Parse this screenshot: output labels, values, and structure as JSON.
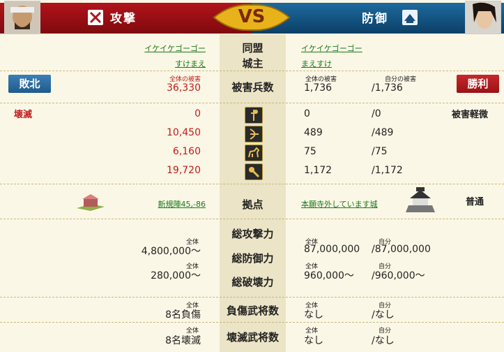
{
  "header": {
    "attack_title": "攻撃",
    "defense_title": "防御",
    "vs": "VS",
    "colors": {
      "attack": "#a31017",
      "defense": "#165a8c",
      "vs_gold": "#e8b31a"
    }
  },
  "alliance": {
    "label": "同盟",
    "attacker": "イケイケゴーゴー",
    "defender": "イケイケゴーゴー"
  },
  "lord": {
    "label": "城主",
    "attacker": "すけまえ",
    "defender": "まえすけ"
  },
  "casualties": {
    "label": "被害兵数",
    "attacker_caption": "全体の被害",
    "attacker_total": "36,330",
    "defender_caption_total": "全体の被害",
    "defender_caption_self": "自分の被害",
    "defender_total": "1,736",
    "defender_self": "/1,736",
    "attacker_result": "敗北",
    "defender_result": "勝利"
  },
  "units": {
    "attacker_status": "壊滅",
    "defender_status": "被害軽微",
    "rows": [
      {
        "icon": "spearman-icon",
        "attacker": "0",
        "defender": "0",
        "defender_self": "/0"
      },
      {
        "icon": "archer-icon",
        "attacker": "10,450",
        "defender": "489",
        "defender_self": "/489"
      },
      {
        "icon": "cavalry-icon",
        "attacker": "6,160",
        "defender": "75",
        "defender_self": "/75"
      },
      {
        "icon": "siege-weapon-icon",
        "attacker": "19,720",
        "defender": "1,172",
        "defender_self": "/1,172"
      }
    ]
  },
  "base": {
    "label": "拠点",
    "attacker": "新規陣45,-86",
    "defender": "本願寺外しています城",
    "defender_status": "普通"
  },
  "power": {
    "labels": [
      "総攻撃力",
      "総防御力",
      "総破壊力"
    ],
    "caption_total": "全体",
    "caption_self": "自分",
    "attacker_attack": "4,800,000〜",
    "attacker_destroy": "280,000〜",
    "defender_defense_total": "87,000,000",
    "defender_defense_self": "/87,000,000",
    "defender_destroy_total": "960,000〜",
    "defender_destroy_self": "/960,000〜"
  },
  "injured": {
    "label": "負傷武将数",
    "caption_total": "全体",
    "caption_self": "自分",
    "attacker": "8名負傷",
    "defender_total": "なし",
    "defender_self": "/なし"
  },
  "destroyed": {
    "label": "壊滅武将数",
    "caption_total": "全体",
    "caption_self": "自分",
    "attacker": "8名壊滅",
    "defender_total": "なし",
    "defender_self": "/なし"
  }
}
